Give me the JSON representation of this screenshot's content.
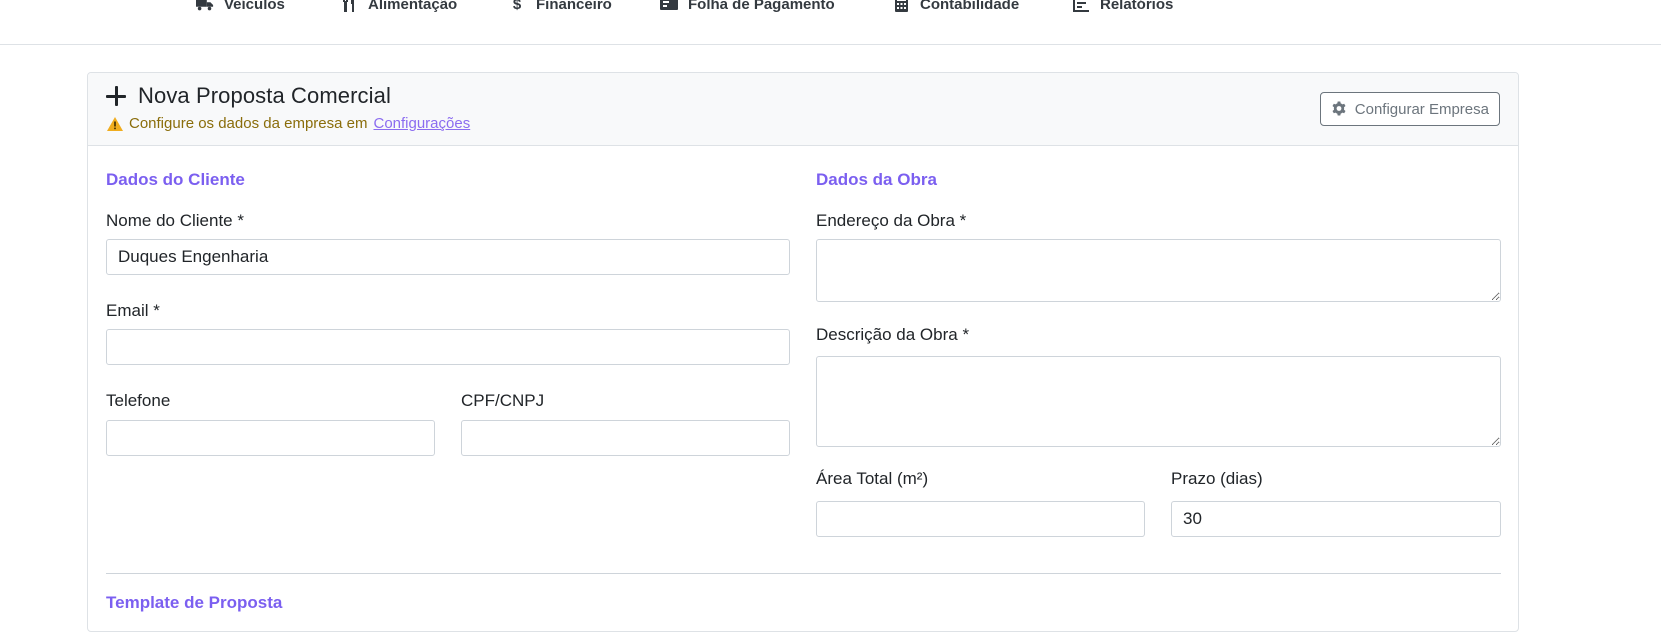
{
  "nav": {
    "items": [
      {
        "label": "Veículos",
        "icon": "truck-icon"
      },
      {
        "label": "Alimentação",
        "icon": "utensils-icon"
      },
      {
        "label": "Financeiro",
        "icon": "dollar-icon"
      },
      {
        "label": "Folha de Pagamento",
        "icon": "money-bill-icon"
      },
      {
        "label": "Contabilidade",
        "icon": "calculator-icon"
      },
      {
        "label": "Relatórios",
        "icon": "chart-list-icon"
      }
    ]
  },
  "header": {
    "title": "Nova Proposta Comercial",
    "warning_text": "Configure os dados da empresa em",
    "warning_link": "Configurações",
    "config_button": "Configurar Empresa"
  },
  "cliente": {
    "section_title": "Dados do Cliente",
    "nome_label": "Nome do Cliente *",
    "nome_value": "Duques Engenharia",
    "email_label": "Email *",
    "email_value": "",
    "telefone_label": "Telefone",
    "telefone_value": "",
    "cpf_label": "CPF/CNPJ",
    "cpf_value": ""
  },
  "obra": {
    "section_title": "Dados da Obra",
    "endereco_label": "Endereço da Obra *",
    "descricao_label": "Descrição da Obra *",
    "area_label": "Área Total (m²)",
    "area_value": "",
    "prazo_label": "Prazo (dias)",
    "prazo_value": "30"
  },
  "template": {
    "section_title": "Template de Proposta"
  },
  "colors": {
    "accent": "#7b5ff0",
    "warning": "#8a6d0b",
    "link": "#8b6cf0",
    "border": "#ced4da"
  }
}
